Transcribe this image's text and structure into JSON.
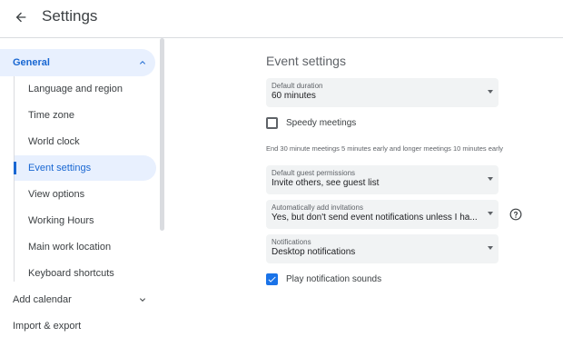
{
  "header": {
    "title": "Settings",
    "back_icon": "arrow-left-icon"
  },
  "sidebar": {
    "general": {
      "label": "General",
      "icon": "chevron-up-icon"
    },
    "items": [
      {
        "label": "Language and region"
      },
      {
        "label": "Time zone"
      },
      {
        "label": "World clock"
      },
      {
        "label": "Event settings",
        "active": true
      },
      {
        "label": "View options"
      },
      {
        "label": "Working Hours"
      },
      {
        "label": "Main work location"
      },
      {
        "label": "Keyboard shortcuts"
      }
    ],
    "add_calendar": {
      "label": "Add calendar",
      "icon": "chevron-down-icon"
    },
    "import_export": {
      "label": "Import & export"
    }
  },
  "main": {
    "section_title": "Event settings",
    "default_duration": {
      "label": "Default duration",
      "value": "60 minutes"
    },
    "speedy_meetings": {
      "label": "Speedy meetings",
      "checked": false
    },
    "speedy_helper": "End 30 minute meetings 5 minutes early and longer meetings 10 minutes early",
    "guest_permissions": {
      "label": "Default guest permissions",
      "value": "Invite others, see guest list"
    },
    "auto_invitations": {
      "label": "Automatically add invitations",
      "value": "Yes, but don't send event notifications unless I ha...",
      "help_icon": "help-circle-icon"
    },
    "notifications": {
      "label": "Notifications",
      "value": "Desktop notifications"
    },
    "play_sounds": {
      "label": "Play notification sounds",
      "checked": true
    }
  },
  "colors": {
    "accent": "#1a73e8",
    "active_bg": "#e8f0fe",
    "active_text": "#1967d2",
    "select_bg": "#f1f3f4"
  }
}
